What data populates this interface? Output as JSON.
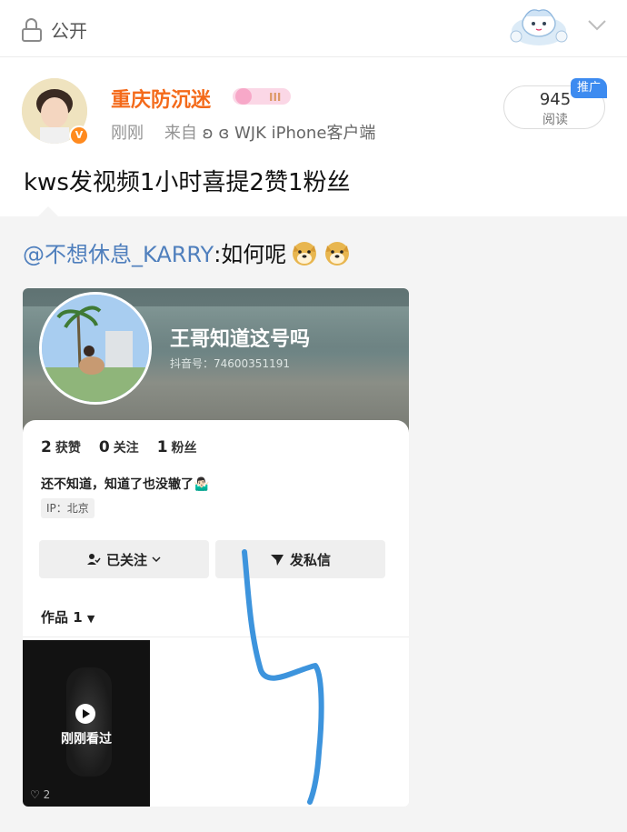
{
  "header": {
    "visibility_label": "公开",
    "lock_icon": "lock-open-icon",
    "mascot": "cartoon-mascot-sticker",
    "chevron": "chevron-down-icon"
  },
  "post": {
    "author": "重庆防沉迷",
    "vip_level": "III",
    "time": "刚刚",
    "source_prefix": "来自",
    "source": "ʚ ɞ WJK iPhone客户端",
    "read_count": "945",
    "read_label": "阅读",
    "promo_tag": "推广",
    "text": "kws发视频1小时喜提2赞1粉丝",
    "accent": "#f46a1a"
  },
  "repost": {
    "mention": "@不想休息_KARRY",
    "text": ":如何呢",
    "emoji": "doge-emoji"
  },
  "screenshot": {
    "name": "王哥知道这号吗",
    "douyin_id": "抖音号：74600351191",
    "stats": [
      {
        "num": "2",
        "label": "获赞"
      },
      {
        "num": "0",
        "label": "关注"
      },
      {
        "num": "1",
        "label": "粉丝"
      }
    ],
    "bio": "还不知道，知道了也没辙了🤷🏻‍♂️",
    "ip": "IP：北京",
    "follow_btn": "已关注",
    "message_btn": "发私信",
    "works_label": "作品 1",
    "video_overlay": "刚刚看过",
    "video_likes": "2"
  }
}
